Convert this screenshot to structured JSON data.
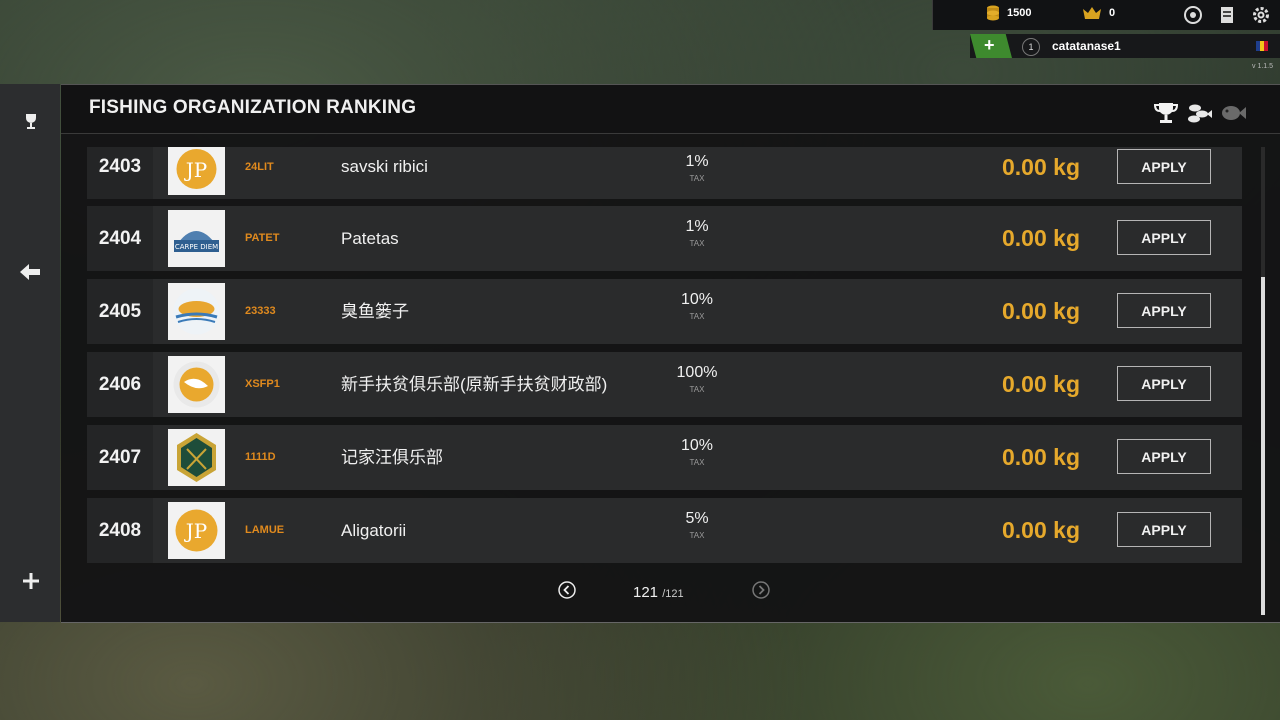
{
  "top_bar": {
    "coins": "1500",
    "gold": "0",
    "username": "catatanase1",
    "level": "1",
    "version": "v 1.1.5"
  },
  "panel": {
    "title": "FISHING ORGANIZATION RANKING"
  },
  "tax_label": "TAX",
  "apply_label": "APPLY",
  "organizations": [
    {
      "rank": "2403",
      "tag": "24LIT",
      "name": "savski ribici",
      "tax": "1%",
      "weight": "0.00 kg"
    },
    {
      "rank": "2404",
      "tag": "PATET",
      "name": "Patetas",
      "tax": "1%",
      "weight": "0.00 kg"
    },
    {
      "rank": "2405",
      "tag": "23333",
      "name": "臭鱼篓子",
      "tax": "10%",
      "weight": "0.00 kg"
    },
    {
      "rank": "2406",
      "tag": "XSFP1",
      "name": "新手扶贫俱乐部(原新手扶贫财政部)",
      "tax": "100%",
      "weight": "0.00 kg"
    },
    {
      "rank": "2407",
      "tag": "1111D",
      "name": "记家汪俱乐部",
      "tax": "10%",
      "weight": "0.00 kg"
    },
    {
      "rank": "2408",
      "tag": "LAMUE",
      "name": "Aligatorii",
      "tax": "5%",
      "weight": "0.00 kg"
    }
  ],
  "pagination": {
    "current": "121",
    "total": "/121"
  },
  "colors": {
    "accent_orange": "#e08a1e",
    "weight_gold": "#e6a92c",
    "plus_green": "#3e8a2e"
  }
}
